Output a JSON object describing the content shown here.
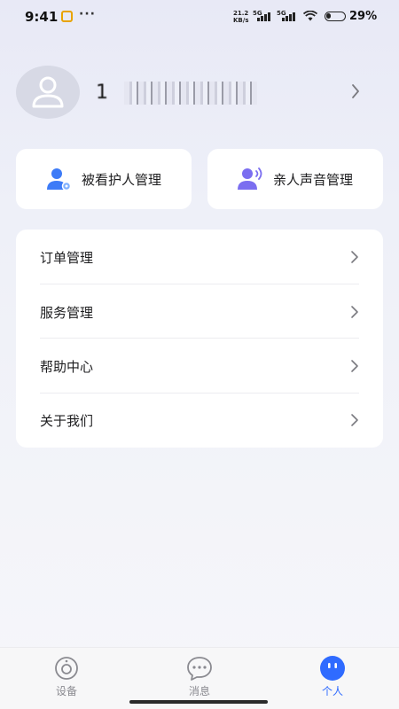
{
  "status_bar": {
    "time": "9:41",
    "net_speed_value": "21.2",
    "net_speed_unit": "KB/s",
    "network_1": "5G",
    "network_2": "5G",
    "battery": "29%",
    "battery_level": 0.29
  },
  "profile": {
    "phone_visible_prefix": "1",
    "phone_masked": true
  },
  "quick_actions": [
    {
      "label": "被看护人管理",
      "icon": "person-gear-icon",
      "color": "#3d7bf7"
    },
    {
      "label": "亲人声音管理",
      "icon": "person-sound-icon",
      "color": "#7b6ef0"
    }
  ],
  "menu": [
    {
      "label": "订单管理"
    },
    {
      "label": "服务管理"
    },
    {
      "label": "帮助中心"
    },
    {
      "label": "关于我们"
    }
  ],
  "tabbar": [
    {
      "label": "设备",
      "icon": "device-icon",
      "active": false
    },
    {
      "label": "消息",
      "icon": "message-icon",
      "active": false
    },
    {
      "label": "个人",
      "icon": "profile-face-icon",
      "active": true
    }
  ],
  "colors": {
    "accent": "#2f6bff",
    "card_bg": "#ffffff",
    "page_bg": "#eef0f8"
  }
}
